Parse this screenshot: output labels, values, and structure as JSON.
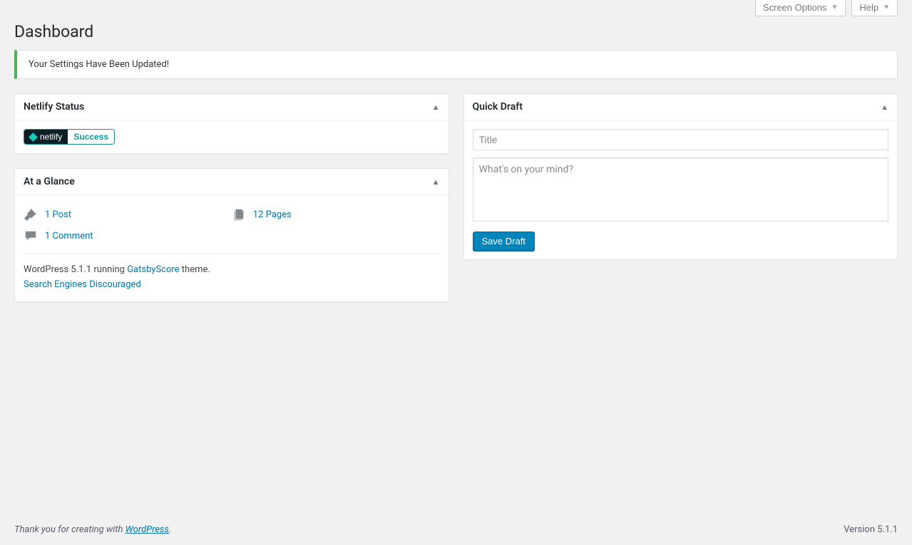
{
  "topbar": {
    "screen_options": "Screen Options",
    "help": "Help"
  },
  "page_title": "Dashboard",
  "notice": {
    "message": "Your Settings Have Been Updated!"
  },
  "netlify": {
    "title": "Netlify Status",
    "brand": "netlify",
    "status": "Success"
  },
  "glance": {
    "title": "At a Glance",
    "posts": "1 Post",
    "pages": "12 Pages",
    "comments": "1 Comment",
    "meta_prefix": "WordPress 5.1.1 running ",
    "theme_name": "GatsbyScore",
    "meta_suffix": " theme.",
    "seo_warning": "Search Engines Discouraged"
  },
  "quickdraft": {
    "title": "Quick Draft",
    "title_placeholder": "Title",
    "content_placeholder": "What's on your mind?",
    "save_label": "Save Draft"
  },
  "footer": {
    "thanks_prefix": "Thank you for creating with ",
    "wp_link": "WordPress",
    "thanks_suffix": ".",
    "version": "Version 5.1.1"
  }
}
